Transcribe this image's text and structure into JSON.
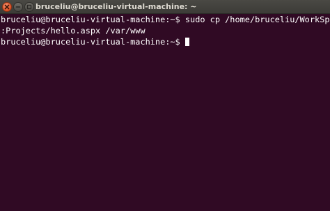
{
  "window": {
    "title": "bruceliu@bruceliu-virtual-machine: ~"
  },
  "terminal": {
    "lines": [
      "bruceliu@bruceliu-virtual-machine:~$ sudo cp /home/bruceliu/WorkSpace/Deployement",
      ":Projects/hello.aspx /var/www",
      "bruceliu@bruceliu-virtual-machine:~$"
    ]
  },
  "colors": {
    "background": "#300a24",
    "text": "#ffffff",
    "titlebar": "#3c3b37",
    "close_button": "#e0562b"
  },
  "icons": [
    "close-icon",
    "minimize-icon",
    "maximize-icon"
  ]
}
